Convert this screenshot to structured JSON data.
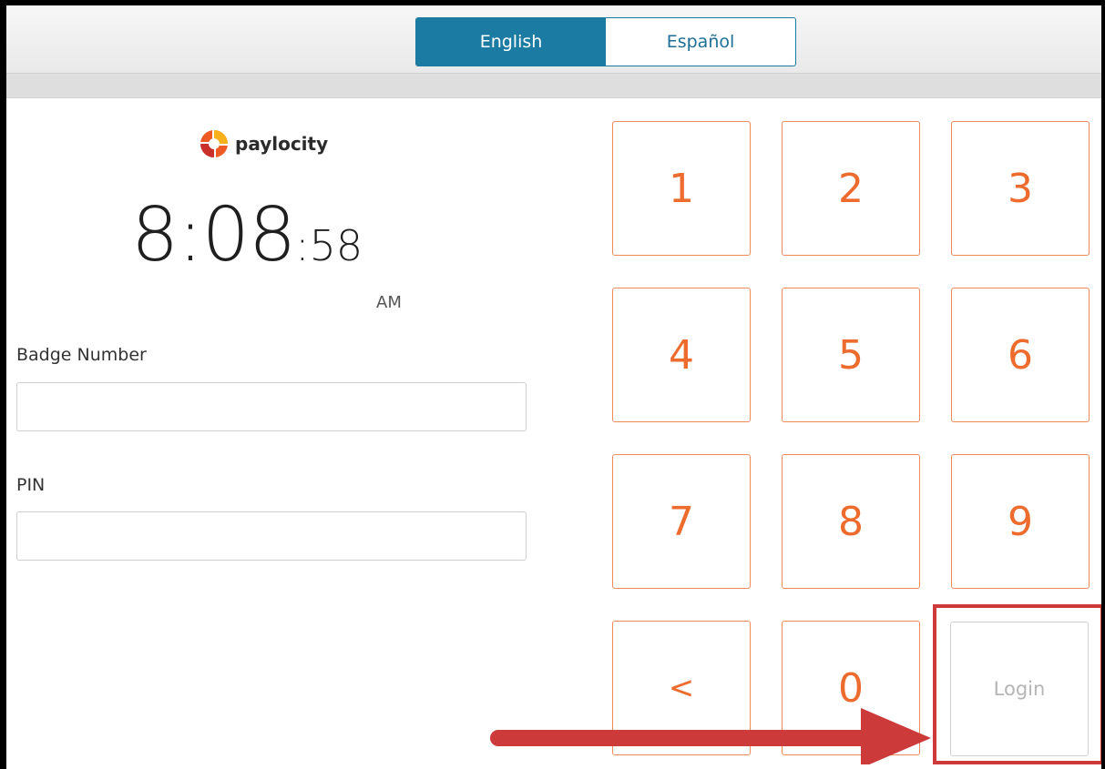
{
  "language_toggle": {
    "english_label": "English",
    "spanish_label": "Español",
    "active": "English"
  },
  "logo": {
    "brand_text": "paylocity"
  },
  "clock": {
    "hours_minutes": "8:08",
    "seconds": ":58",
    "ampm": "AM"
  },
  "form": {
    "badge_label": "Badge Number",
    "badge_value": "",
    "pin_label": "PIN",
    "pin_value": ""
  },
  "keypad": {
    "keys": [
      "1",
      "2",
      "3",
      "4",
      "5",
      "6",
      "7",
      "8",
      "9",
      "<",
      "0",
      "Login"
    ]
  },
  "colors": {
    "accent_blue": "#1b7ba3",
    "keypad_orange": "#ec6b2d",
    "highlight_red": "#cc3a3a"
  }
}
